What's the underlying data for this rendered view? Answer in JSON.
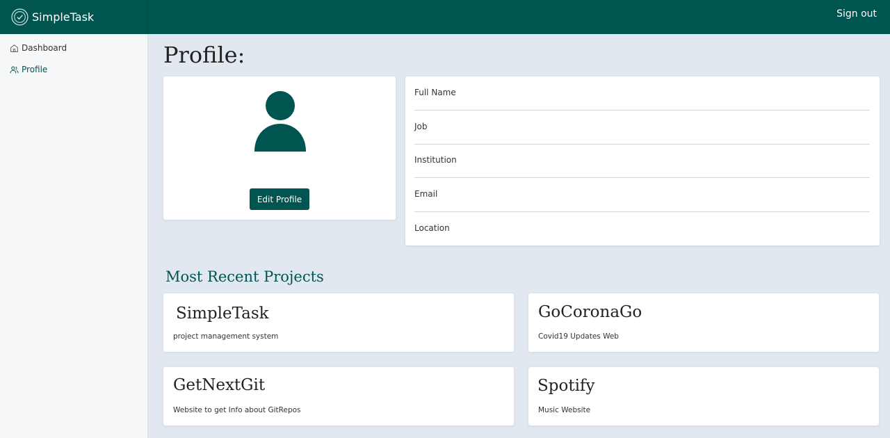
{
  "header": {
    "brand": "SimpleTask",
    "signout_label": "Sign out"
  },
  "sidebar": {
    "items": [
      {
        "label": "Dashboard",
        "icon": "home-icon",
        "active": false
      },
      {
        "label": "Profile",
        "icon": "users-icon",
        "active": true
      }
    ]
  },
  "profile": {
    "title": "Profile:",
    "edit_button": "Edit Profile",
    "fields": [
      "Full Name",
      "Job",
      "Institution",
      "Email",
      "Location"
    ]
  },
  "projects": {
    "section_title": "Most Recent Projects",
    "items": [
      {
        "title": "SimpleTask",
        "description": "project management system"
      },
      {
        "title": "GoCoronaGo",
        "description": "Covid19 Updates Web"
      },
      {
        "title": "GetNextGit",
        "description": "Website to get Info about GitRepos"
      },
      {
        "title": "Spotify",
        "description": "Music Website"
      }
    ]
  },
  "colors": {
    "primary": "#015551",
    "background": "#e2e8f0",
    "sidebar": "#f5f7f9"
  }
}
